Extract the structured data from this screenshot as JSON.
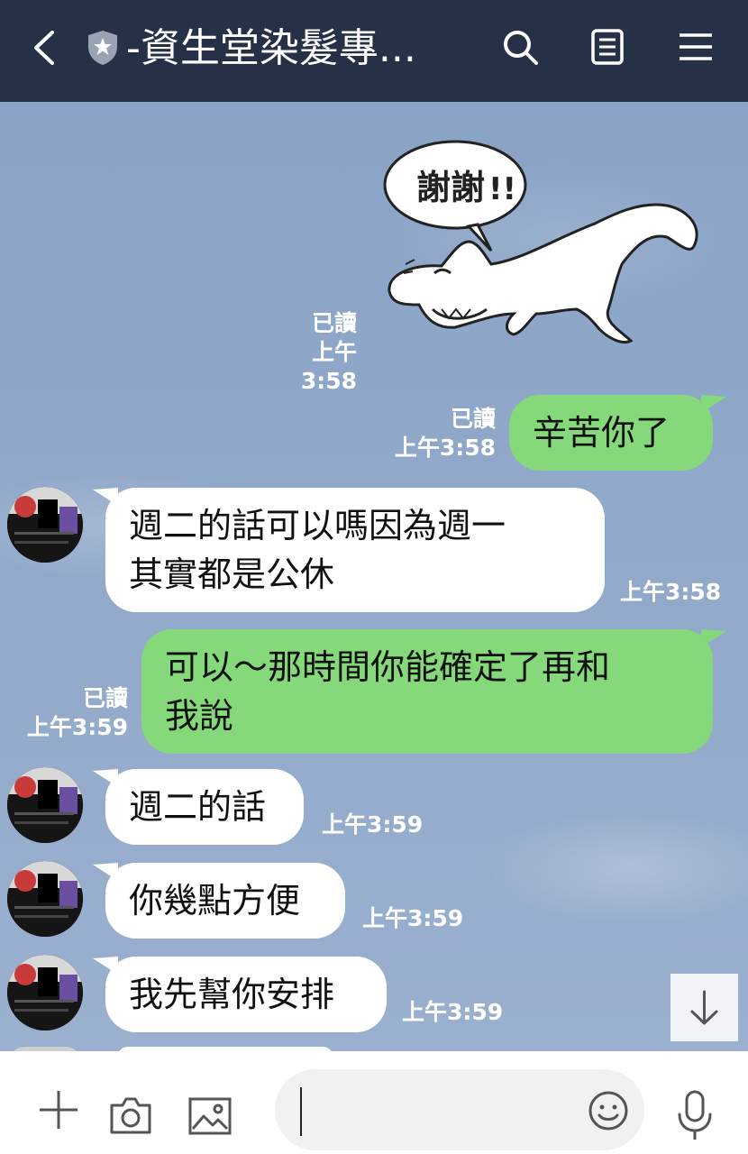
{
  "header": {
    "title": "-資生堂染髮專...",
    "icons": [
      "back-arrow-icon",
      "shield-star-icon",
      "search-icon",
      "notes-icon",
      "menu-icon"
    ]
  },
  "sticker": {
    "text": "謝謝"
  },
  "messages": [
    {
      "read": "已讀",
      "time": "上午3:58"
    },
    {
      "text": "辛苦你了",
      "read": "已讀",
      "time": "上午3:58"
    },
    {
      "line1": "週二的話可以嗎因為週一",
      "line2": "其實都是公休",
      "time": "上午3:58"
    },
    {
      "line1": "可以～那時間你能確定了再和",
      "line2": "我說",
      "read": "已讀",
      "time": "上午3:59"
    },
    {
      "text": "週二的話",
      "time": "上午3:59"
    },
    {
      "text": "你幾點方便",
      "time": "上午3:59"
    },
    {
      "text": "我先幫你安排",
      "time": "上午3:59"
    }
  ],
  "footer": {
    "input_value": "",
    "icons": [
      "plus-icon",
      "camera-icon",
      "image-icon",
      "emoji-icon",
      "microphone-icon"
    ]
  },
  "colors": {
    "header": "#263148",
    "outgoing": "#86d97a",
    "incoming": "#ffffff",
    "background": "#8ea6c8"
  }
}
